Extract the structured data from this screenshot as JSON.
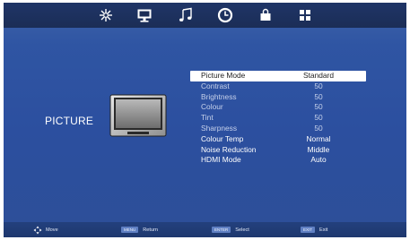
{
  "topbar": {
    "icons": [
      "snowflake-settings-icon",
      "monitor-icon",
      "music-note-icon",
      "clock-icon",
      "lock-briefcase-icon",
      "grid-icon"
    ],
    "active_index": 1
  },
  "page": {
    "title": "PICTURE"
  },
  "menu": {
    "rows": [
      {
        "label": "Picture Mode",
        "value": "Standard"
      },
      {
        "label": "Contrast",
        "value": "50"
      },
      {
        "label": "Brightness",
        "value": "50"
      },
      {
        "label": "Colour",
        "value": "50"
      },
      {
        "label": "Tint",
        "value": "50"
      },
      {
        "label": "Sharpness",
        "value": "50"
      },
      {
        "label": "Colour Temp",
        "value": "Normal"
      },
      {
        "label": "Noise Reduction",
        "value": "Middle"
      },
      {
        "label": "HDMI Mode",
        "value": "Auto"
      }
    ]
  },
  "bottombar": {
    "move_label": "Move",
    "return_key": "MENU",
    "return_label": "Return",
    "select_key": "ENTER",
    "select_label": "Select",
    "exit_key": "EXIT",
    "exit_label": "Exit"
  },
  "colors": {
    "background": "#2c4f9f",
    "topbar": "#1b2d56",
    "selected_row": "#ffffff"
  }
}
